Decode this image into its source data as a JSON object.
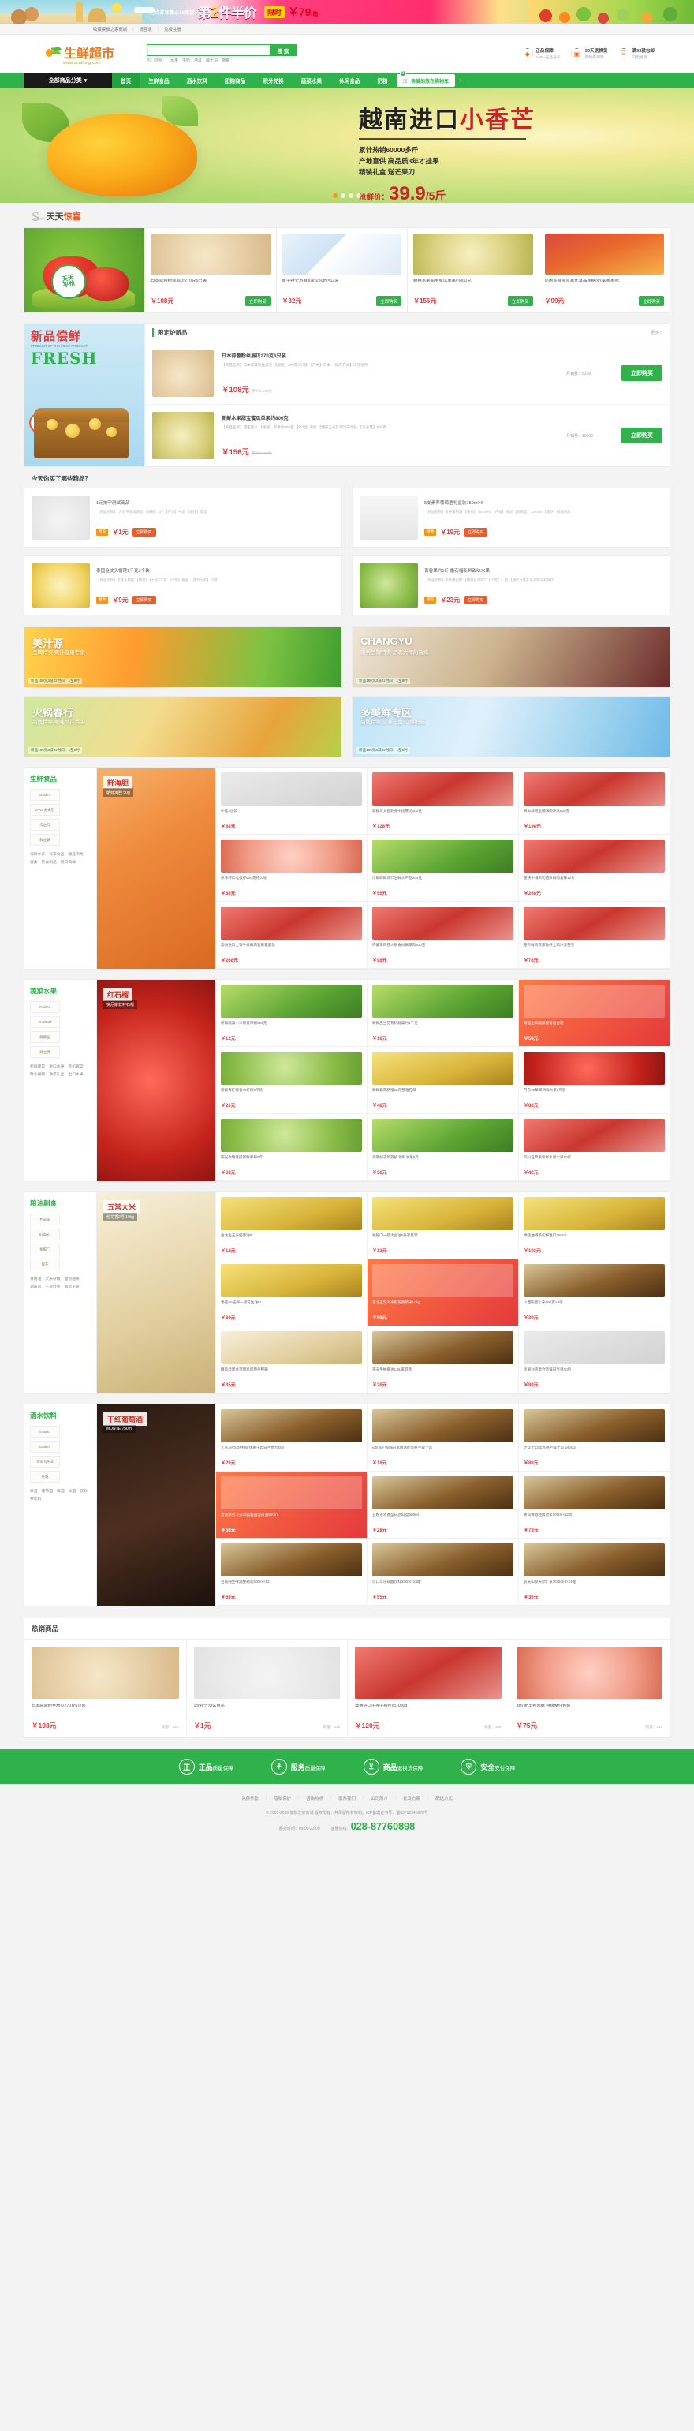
{
  "promo": {
    "sub_text": "阿克苏冰糖心16度甜",
    "big_text_1": "第",
    "big_num": "2",
    "big_text_2": "件半价",
    "tag": "限时",
    "price": "￥79",
    "price_unit": "/箱"
  },
  "topbar": {
    "links": [
      "收藏模板之家商城",
      "请登录",
      "免费注册"
    ]
  },
  "header": {
    "logo_name": "生鲜超市",
    "logo_url": "www.ocailong.com",
    "search_placeholder": "",
    "search_value": "",
    "search_button": "搜 索",
    "hot_label": "热门搜索：",
    "hot_words": [
      "水果",
      "牛奶",
      "测试",
      "威士忌",
      "蔬菜"
    ],
    "badges": [
      {
        "icon": "diamond-icon",
        "glyph": "◈",
        "title": "正品保障",
        "sub": "100%正品低价"
      },
      {
        "icon": "box-icon",
        "glyph": "▣",
        "title": "30天退换货",
        "sub": "购物有保障"
      },
      {
        "icon": "gift-icon",
        "glyph": "🎁",
        "title": "满99就包邮",
        "sub": "闪电发货"
      }
    ]
  },
  "nav": {
    "all_categories": "全部商品分类",
    "items": [
      "首页",
      "生鲜食品",
      "酒水饮料",
      "团购商品",
      "积分兑换",
      "蔬菜水果",
      "休闲食品",
      "奶粉"
    ],
    "active_index": 0,
    "cart_label": "亲爱的放在购物车",
    "cart_count": "0",
    "arrow": "›"
  },
  "hero": {
    "title_dark": "越南进口",
    "title_red": "小香芒",
    "lines": [
      "累计热销60000多斤",
      "产地直供 高品质3年才挂果",
      "精装礼盒 送芒果刀"
    ],
    "price_label": "抢鲜价：",
    "price_num": "39.9",
    "price_unit": "/5斤",
    "dots": 4,
    "active_dot": 0
  },
  "surprise": {
    "title_S": "S",
    "title_cn_black": "天天",
    "title_cn_red": "惊喜",
    "title_en": "urprise",
    "seal_line1": "天天",
    "seal_line2": "平价",
    "products": [
      {
        "name": "日本蒜蓉粉丝扇贝270克6只装",
        "price": "￥108元",
        "buy": "立即购买",
        "img": "im-food1"
      },
      {
        "name": "蒙牛特仑苏有机奶250ml×12盒",
        "price": "￥32元",
        "buy": "立即购买",
        "img": "im-milkbox"
      },
      {
        "name": "新鲜水果甜宝蜜瓜单果约800克",
        "price": "￥156元",
        "buy": "立即购买",
        "img": "im-melon"
      },
      {
        "name": "休闲零食零食氧化食品焦糖/奶油/椒麻味",
        "price": "￥99元",
        "buy": "立即购买",
        "img": "im-snack"
      }
    ]
  },
  "fresh_panel": {
    "side_title": "新品偿鲜",
    "side_sub": "PRODUCT OF THE FIRST PRODUCT",
    "side_fresh": "FRESH",
    "side_badge": "5",
    "side_tiny": "折起",
    "header_title": "限定炉新品",
    "header_more": "更多 »",
    "rows": [
      {
        "name": "日本蒜蓉粉丝扇贝270克6只装",
        "desc": "【商品名称】日本蒜蓉粉丝扇贝  【规格】270克/6只装  【产地】日本  【储存方式】冷冻保存",
        "price": "￥108元",
        "old_price": "原价￥166元",
        "meta": "月销量：5298",
        "cta": "立即购买",
        "img": "im-food1"
      },
      {
        "name": "新鲜水果甜宝蜜瓜单果约800克",
        "desc": "【商品名称】甜宝蜜瓜  【规格】单果约800克  【产地】海南  【储存方式】阴凉干燥处  【净含量】800克",
        "price": "￥156元",
        "old_price": "原价￥186元",
        "meta": "月销量：10009",
        "cta": "立即购买",
        "img": "im-melon"
      }
    ]
  },
  "recommend": {
    "title": "今天你买了哪些精品？",
    "cards": [
      {
        "name": "1元抢守测试商品",
        "desc": "【商品名称】1元抢守测试商品 【规格】1件 【产地】中国 【储存】常温",
        "tag": "抢购",
        "price": "￥1元",
        "buy": "立即购买",
        "img": "im-toy"
      },
      {
        "name": "5支素养葡萄酒礼盒装750ml×6",
        "desc": "【商品名称】素养葡萄酒 【规格】750ml×6 【产地】法国 【酒精度】12%vol 【储存】避光阴凉",
        "tag": "特惠",
        "price": "￥19元",
        "buy": "立即购买",
        "img": "im-bottleset"
      },
      {
        "name": "泰国金枕头榴莲1千克3个装",
        "desc": "【商品名称】金枕头榴莲 【规格】1千克3个装 【产地】泰国 【储存方式】冷藏",
        "tag": "尝鲜",
        "price": "￥9元",
        "buy": "立即购买",
        "img": "im-banana"
      },
      {
        "name": "百香果约5斤 番石榴新鲜甜味水果",
        "desc": "【商品名称】新鲜番石榴 【规格】约5斤 【产地】广西 【储存方式】常温阴凉处保存",
        "tag": "蔬农",
        "price": "￥23元",
        "buy": "立即购买",
        "img": "im-greenfruit"
      }
    ]
  },
  "ads_row1": [
    {
      "big": "美汁源",
      "sub": "品牌特卖\n果汁健康专家",
      "caption": "新品150元3减22时间：1至9时",
      "img": "im-juice"
    },
    {
      "big": "CHANGYU",
      "sub": "张裕品牌特卖\n品酒大师的选择",
      "caption": "新品180元3减22时间：1至9时",
      "img": "im-wine"
    }
  ],
  "ads_row2": [
    {
      "big": "火锅春行",
      "sub": "品牌特卖\n美味尽在舌尖",
      "caption": "新品100元3减22时间：1至9时",
      "img": "im-feast"
    },
    {
      "big": "多美鲜专区",
      "sub": "品牌特卖\n营养丰富 口感细腻",
      "caption": "新品100元3减22时间：1至9时",
      "img": "im-dairy"
    }
  ],
  "categories": [
    {
      "title": "生鲜食品",
      "brands": [
        "Golden",
        "KVer 太太乐",
        "海之味",
        "鲜之源"
      ],
      "links": [
        "海鲜水产",
        "冷冻食品",
        "精品肉类",
        "蛋类",
        "熟食制品",
        "进口海鲜"
      ],
      "hero_label": "鲜海胆",
      "hero_label2": "朝鲜海胆 50g",
      "hero_img": "im-urchin",
      "items": [
        {
          "name": "牛蛙2份装",
          "price": "￥68元",
          "img": "im-grey",
          "promo": false
        },
        {
          "name": "新鲜三文鱼刺身中段厚切500克",
          "price": "￥128元",
          "img": "im-meat",
          "promo": false
        },
        {
          "name": "日本鲜鲍鱼捕涡肉冷冻800克",
          "price": "￥198元",
          "img": "im-meat",
          "promo": false
        },
        {
          "name": "冷冻虾仁北极虾500克特大号",
          "price": "￥88元",
          "img": "im-shrimp",
          "promo": false
        },
        {
          "name": "冷鲜鲜鲜虾仁生鲜水产品300克",
          "price": "￥56元",
          "img": "im-veg",
          "promo": false
        },
        {
          "name": "整块牛排原切西冷眼肉套餐10片",
          "price": "￥268元",
          "img": "im-meat",
          "promo": false
        },
        {
          "name": "澳洲进口上等牛排眼肉套餐家庭装",
          "price": "￥268元",
          "img": "im-meat",
          "promo": false
        },
        {
          "name": "内蒙羊肉卷火锅食材涮羊肉500克",
          "price": "￥98元",
          "img": "im-meat",
          "promo": false
        },
        {
          "name": "整只鲜鸡农家散养土鸡冷冻整只",
          "price": "￥78元",
          "img": "im-meat",
          "promo": false
        }
      ]
    },
    {
      "title": "蔬菜水果",
      "brands": [
        "Golden",
        "SUMMIT",
        "鲜果园",
        "绿之源"
      ],
      "links": [
        "新鲜蔬菜",
        "进口水果",
        "有机蔬菜",
        "时令果蔬",
        "净菜礼盒",
        "出口水果"
      ],
      "hero_label": "红石榴",
      "hero_label2": "突尼斯软籽石榴",
      "hero_img": "im-pom",
      "items": [
        {
          "name": "新鲜蔬菜小米椒青辣椒500克",
          "price": "￥12元",
          "img": "im-veg",
          "promo": false
        },
        {
          "name": "新鲜西兰花有机蔬菜约1千克",
          "price": "￥18元",
          "img": "im-veg",
          "promo": false
        },
        {
          "name": "精品生鲜蔬菜套餐组合装",
          "price": "￥58元",
          "img": "im-veg",
          "promo": true
        },
        {
          "name": "新鲜青柠檬香水柠檬2斤装",
          "price": "￥26元",
          "img": "im-greenfruit",
          "promo": false
        },
        {
          "name": "新鲜赣南脐橙10斤整箱包邮",
          "price": "￥48元",
          "img": "im-oil",
          "promo": false
        },
        {
          "name": "丹东99草莓新鲜大果3斤装",
          "price": "￥88元",
          "img": "im-pom",
          "promo": false
        },
        {
          "name": "阳光玫瑰青提新鲜葡萄5斤",
          "price": "￥68元",
          "img": "im-greenfruit",
          "promo": false
        },
        {
          "name": "海南妃子笑荔枝 新鲜水果5斤",
          "price": "￥58元",
          "img": "im-veg",
          "promo": false
        },
        {
          "name": "四川丑苹果新鲜水果大果10斤",
          "price": "￥42元",
          "img": "im-meat",
          "promo": false
        }
      ]
    },
    {
      "title": "粮油副食",
      "brands": [
        "Prairie",
        "Instinct",
        "福临门",
        "鲁花"
      ],
      "links": [
        "食用油",
        "大米杂粮",
        "面粉面条",
        "调味品",
        "干货炒货",
        "南北干货"
      ],
      "hero_label": "五常大米",
      "hero_label2": "稻花香2号 10kg",
      "hero_img": "im-rice",
      "items": [
        {
          "name": "金龙鱼玉米胚芽油5L",
          "price": "￥12元",
          "img": "im-oil",
          "promo": false
        },
        {
          "name": "福临门一级大豆油5升家庭装",
          "price": "￥13元",
          "img": "im-oil",
          "promo": false
        },
        {
          "name": "橄榄油特级初榨进口750ml",
          "price": "￥193元",
          "img": "im-oil",
          "promo": false
        },
        {
          "name": "鲁花5S压榨一级花生油5L",
          "price": "￥69元",
          "img": "im-oil",
          "promo": false
        },
        {
          "name": "东北五常大米稻花香新米10kg",
          "price": "￥99元",
          "img": "im-rice",
          "promo": true
        },
        {
          "name": "山西陈醋小米500克×3袋",
          "price": "￥39元",
          "img": "im-liquor",
          "promo": false
        },
        {
          "name": "精品挂面龙须面鸡蛋面条整箱",
          "price": "￥35元",
          "img": "im-rice",
          "promo": false
        },
        {
          "name": "海天生抽酱油1.9L家庭装",
          "price": "￥28元",
          "img": "im-liquor",
          "promo": false
        },
        {
          "name": "坚果炒货混合装每日坚果30包",
          "price": "￥89元",
          "img": "im-grey",
          "promo": false
        }
      ]
    },
    {
      "title": "酒水饮料",
      "brands": [
        "Instinct",
        "Golden",
        "SherryRed",
        "长城"
      ],
      "links": [
        "白酒",
        "葡萄酒",
        "啤酒",
        "洋酒",
        "饮料",
        "茶饮料"
      ],
      "hero_label": "干红葡萄酒",
      "hero_label2": "MONTE 750ml",
      "hero_img": "im-winedark",
      "items": [
        {
          "name": "人头马VSOP特级优质干邑白兰地700ml",
          "price": "￥29元",
          "img": "im-liquor",
          "promo": false
        },
        {
          "name": "johnnie Walker黑牌调配苏格兰威士忌",
          "price": "￥18元",
          "img": "im-liquor",
          "promo": false
        },
        {
          "name": "芝华士12年苏格兰威士忌 whisky",
          "price": "￥88元",
          "img": "im-liquor",
          "promo": false
        },
        {
          "name": "贵州茅台飞天53度酱香型白酒500ml",
          "price": "￥58元",
          "img": "im-liquor",
          "promo": true
        },
        {
          "name": "五粮液浓香型白酒52度500ml",
          "price": "￥28元",
          "img": "im-liquor",
          "promo": false
        },
        {
          "name": "青岛啤酒经典原浆500ml×12听",
          "price": "￥78元",
          "img": "im-liquor",
          "promo": false
        },
        {
          "name": "百威纯生啤酒整箱装500ml×12",
          "price": "￥68元",
          "img": "im-liquor",
          "promo": false
        },
        {
          "name": "可口可乐碳酸饮料330ml×24罐",
          "price": "￥55元",
          "img": "im-liquor",
          "promo": false
        },
        {
          "name": "农夫山泉天然矿泉水550ml×24瓶",
          "price": "￥36元",
          "img": "im-liquor",
          "promo": false
        }
      ]
    }
  ],
  "hot": {
    "title": "热销商品",
    "items": [
      {
        "name": "日本蒜蓉粉丝扇贝270克6只装",
        "price": "￥108元",
        "meta": "销量：525",
        "img": "im-food1"
      },
      {
        "name": "1元抢守测试商品",
        "price": "￥1元",
        "meta": "销量：413",
        "img": "im-toy"
      },
      {
        "name": "澳洲进口牛排牛柳片肉1000g",
        "price": "￥120元",
        "meta": "销量：398",
        "img": "im-meat"
      },
      {
        "name": "鲜切肥羊卷肉膳 特级整件包装",
        "price": "￥75元",
        "meta": "销量：356",
        "img": "im-shrimp"
      }
    ]
  },
  "footer": {
    "guarantees": [
      {
        "icon": "zheng-icon",
        "glyph": "正",
        "bold": "正品",
        "rest": "质量保障"
      },
      {
        "icon": "service-icon",
        "glyph": "⚘",
        "bold": "服务",
        "rest": "质量保障"
      },
      {
        "icon": "return-icon",
        "glyph": "⊻",
        "bold": "商品",
        "rest": "退换货保障"
      },
      {
        "icon": "shield-icon",
        "glyph": "⛨",
        "bold": "安全",
        "rest": "支付保障"
      }
    ],
    "links": [
      "免费条款",
      "隐私保护",
      "咨询热点",
      "联系我们",
      "公司简介",
      "批发方案",
      "配送方式"
    ],
    "copyright": "© 2005-2018 模板之家商城 版权所有，并保留所有权利。ICP备案证书号：蜀ICP12345678号",
    "service_time_label": "服务时间：09:00-23:00",
    "hotline_label": "客服热线：",
    "hotline": "028-87760898"
  }
}
